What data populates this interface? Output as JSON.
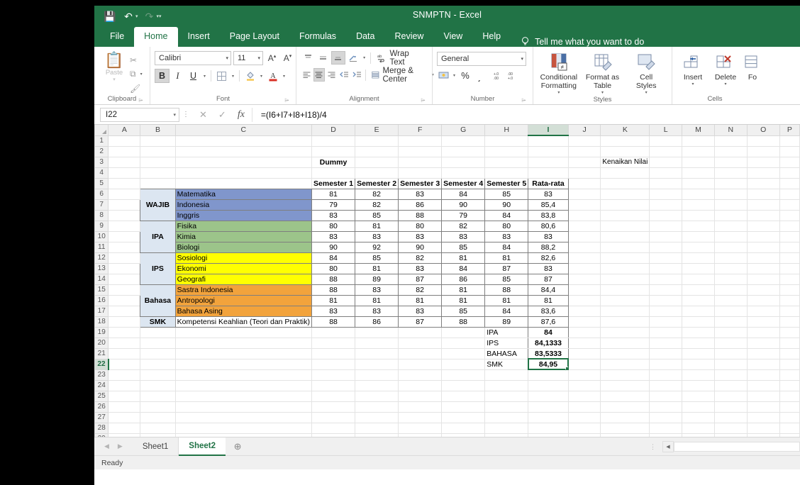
{
  "window": {
    "title": "SNMPTN  -  Excel",
    "quick_access": [
      {
        "name": "save-icon",
        "glyph": "💾"
      },
      {
        "name": "undo-icon",
        "glyph": "↶"
      },
      {
        "name": "redo-icon",
        "glyph": "↷"
      },
      {
        "name": "customize-qat-icon",
        "glyph": "▾"
      }
    ]
  },
  "ribbon_tabs": [
    {
      "label": "File",
      "active": false
    },
    {
      "label": "Home",
      "active": true
    },
    {
      "label": "Insert",
      "active": false
    },
    {
      "label": "Page Layout",
      "active": false
    },
    {
      "label": "Formulas",
      "active": false
    },
    {
      "label": "Data",
      "active": false
    },
    {
      "label": "Review",
      "active": false
    },
    {
      "label": "View",
      "active": false
    },
    {
      "label": "Help",
      "active": false
    }
  ],
  "tell_me": "Tell me what you want to do",
  "ribbon": {
    "clipboard": {
      "label": "Clipboard",
      "paste": "Paste",
      "cut": "✂",
      "copy": "⧉",
      "format_painter": "🖌"
    },
    "font": {
      "label": "Font",
      "font_name": "Calibri",
      "font_size": "11",
      "grow": "A",
      "shrink": "A",
      "bold": "B",
      "italic": "I",
      "underline": "U",
      "borders": "⊞",
      "fill_color": "🪣",
      "font_color": "A"
    },
    "alignment": {
      "label": "Alignment",
      "wrap_text": "Wrap Text",
      "merge_center": "Merge & Center"
    },
    "number": {
      "label": "Number",
      "format": "General",
      "accounting": "💵",
      "percent": "%",
      "comma": "͵",
      "increase_decimal": ".00",
      "decrease_decimal": ".00"
    },
    "styles": {
      "label": "Styles",
      "conditional_formatting": "Conditional\nFormatting",
      "conditional_l1": "Conditional",
      "conditional_l2": "Formatting",
      "format_table_l1": "Format as",
      "format_table_l2": "Table",
      "cell_styles_l1": "Cell",
      "cell_styles_l2": "Styles"
    },
    "cells": {
      "label": "Cells",
      "insert": "Insert",
      "delete": "Delete",
      "format": "Fo"
    }
  },
  "formula_bar": {
    "name_box": "I22",
    "formula": "=(I6+I7+I8+I18)/4",
    "cancel": "✕",
    "enter": "✓",
    "fx": "fx"
  },
  "sheet": {
    "columns": [
      "A",
      "B",
      "C",
      "D",
      "E",
      "F",
      "G",
      "H",
      "I",
      "J",
      "K",
      "L",
      "M",
      "N",
      "O",
      "P"
    ],
    "selected_column": "I",
    "selected_row": 22,
    "active_cell": "I22",
    "rows_visible": 29,
    "labels": {
      "dummy": "Dummy",
      "kenaikan": "Kenaikan Nilai"
    },
    "table_headers": [
      "",
      "",
      "Semester 1",
      "Semester 2",
      "Semester 3",
      "Semester 4",
      "Semester 5",
      "Rata-rata"
    ],
    "groups": [
      {
        "name": "WAJIB",
        "color": "#8096cc",
        "subjects": [
          {
            "name": "Matematika",
            "values": [
              "81",
              "82",
              "83",
              "84",
              "85"
            ],
            "average": "83"
          },
          {
            "name": "Indonesia",
            "values": [
              "79",
              "82",
              "86",
              "90",
              "90"
            ],
            "average": "85,4"
          },
          {
            "name": "Inggris",
            "values": [
              "83",
              "85",
              "88",
              "79",
              "84"
            ],
            "average": "83,8"
          }
        ]
      },
      {
        "name": "IPA",
        "color": "#9cc48a",
        "subjects": [
          {
            "name": "Fisika",
            "values": [
              "80",
              "81",
              "80",
              "82",
              "80"
            ],
            "average": "80,6"
          },
          {
            "name": "Kimia",
            "values": [
              "83",
              "83",
              "83",
              "83",
              "83"
            ],
            "average": "83"
          },
          {
            "name": "Biologi",
            "values": [
              "90",
              "92",
              "90",
              "85",
              "84"
            ],
            "average": "88,2"
          }
        ]
      },
      {
        "name": "IPS",
        "color": "#ffff00",
        "subjects": [
          {
            "name": "Sosiologi",
            "values": [
              "84",
              "85",
              "82",
              "81",
              "81"
            ],
            "average": "82,6"
          },
          {
            "name": "Ekonomi",
            "values": [
              "80",
              "81",
              "83",
              "84",
              "87"
            ],
            "average": "83"
          },
          {
            "name": "Geografi",
            "values": [
              "88",
              "89",
              "87",
              "86",
              "85"
            ],
            "average": "87"
          }
        ]
      },
      {
        "name": "Bahasa",
        "color": "#f2a33c",
        "subjects": [
          {
            "name": "Sastra Indonesia",
            "values": [
              "88",
              "83",
              "82",
              "81",
              "88"
            ],
            "average": "84,4"
          },
          {
            "name": "Antropologi",
            "values": [
              "81",
              "81",
              "81",
              "81",
              "81"
            ],
            "average": "81"
          },
          {
            "name": "Bahasa Asing",
            "values": [
              "83",
              "83",
              "83",
              "85",
              "84"
            ],
            "average": "83,6"
          }
        ]
      },
      {
        "name": "SMK",
        "color": "#ffffff",
        "subjects": [
          {
            "name": "Kompetensi Keahlian (Teori dan Praktik)",
            "values": [
              "88",
              "86",
              "87",
              "88",
              "89"
            ],
            "average": "87,6"
          }
        ]
      }
    ],
    "summary": [
      {
        "label": "IPA",
        "value": "84",
        "selected": false
      },
      {
        "label": "IPS",
        "value": "84,1333",
        "selected": false
      },
      {
        "label": "BAHASA",
        "value": "83,5333",
        "selected": false
      },
      {
        "label": "SMK",
        "value": "84,95",
        "selected": true
      }
    ]
  },
  "sheet_tabs": {
    "prev": "◀",
    "next": "▶",
    "tabs": [
      {
        "label": "Sheet1",
        "active": false
      },
      {
        "label": "Sheet2",
        "active": true
      }
    ],
    "add": "⊕"
  },
  "status_bar": {
    "text": "Ready"
  },
  "colors": {
    "brand_green": "#217346",
    "wajib": "#8096cc",
    "ipa": "#9cc48a",
    "ips": "#ffff00",
    "bahasa": "#f2a33c",
    "category": "#dce6f1"
  }
}
